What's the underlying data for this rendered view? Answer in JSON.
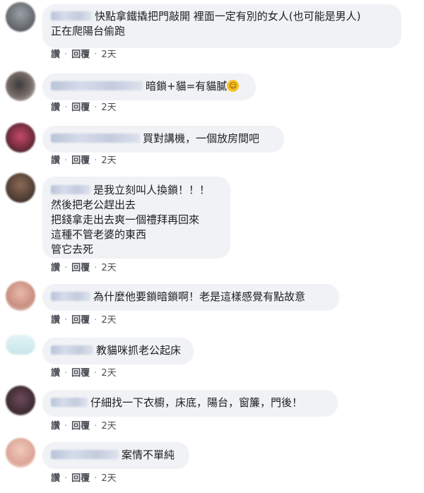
{
  "comments": [
    {
      "lines": [
        "快點拿鐵撬把門敲開 裡面一定有別的女人(也可能是男人)",
        "正在爬陽台偷跑"
      ],
      "like": "讚",
      "reply": "回覆",
      "time": "2天"
    },
    {
      "lines": [
        "暗鎖+貓=有貓膩"
      ],
      "like": "讚",
      "reply": "回覆",
      "time": "2天",
      "emoji": "smiling-face-icon"
    },
    {
      "lines": [
        "買對講機，一個放房間吧"
      ],
      "like": "讚",
      "reply": "回覆",
      "time": "2天"
    },
    {
      "lines": [
        "是我立刻叫人換鎖！！！",
        "然後把老公趕出去",
        "把錢拿走出去爽一個禮拜再回來",
        "這種不管老婆的東西",
        "管它去死"
      ],
      "like": "讚",
      "reply": "回覆",
      "time": "2天"
    },
    {
      "lines": [
        "為什麼他要鎖暗鎖啊！老是這樣感覺有點故意"
      ],
      "like": "讚",
      "reply": "回覆",
      "time": "2天"
    },
    {
      "lines": [
        "教貓咪抓老公起床"
      ],
      "like": "讚",
      "reply": "回覆",
      "time": "2天"
    },
    {
      "lines": [
        "仔細找一下衣櫥，床底，陽台，窗簾，門後！"
      ],
      "like": "讚",
      "reply": "回覆",
      "time": "2天"
    },
    {
      "lines": [
        "案情不單純"
      ],
      "like": "讚",
      "reply": "回覆",
      "time": "2天"
    }
  ],
  "colors": {
    "bubble": "#f0f2f5",
    "text": "#1c1e21",
    "meta": "#4b4f56"
  }
}
